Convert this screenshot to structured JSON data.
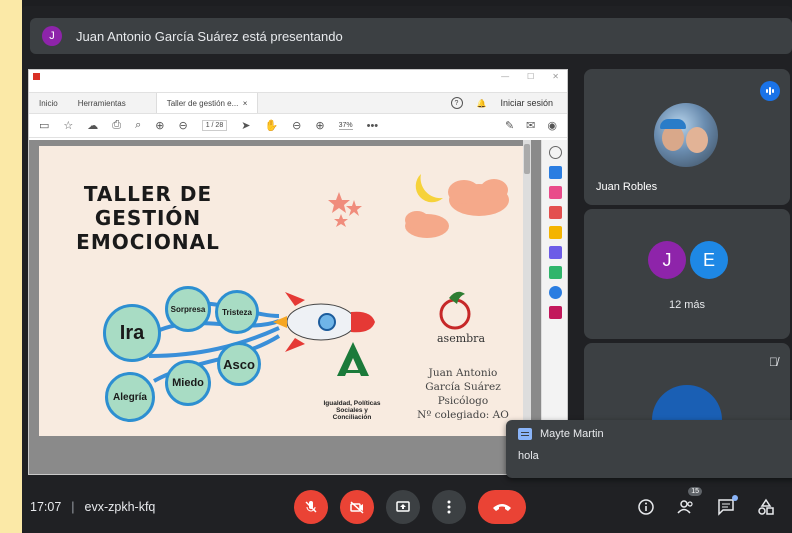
{
  "banner": {
    "avatar": "J",
    "text": "Juan Antonio García Suárez está presentando"
  },
  "presentation": {
    "tabs": [
      "Inicio",
      "Herramientas",
      "Taller de gestión e..."
    ],
    "sign_in": "Iniciar sesión",
    "page_indicator": "1 / 28",
    "zoom": "37%",
    "slide": {
      "title_lines": [
        "TALLER DE",
        "GESTIÓN",
        "EMOCIONAL"
      ],
      "emotions": [
        "Ira",
        "Sorpresa",
        "Tristeza",
        "Asco",
        "Miedo",
        "Alegría"
      ],
      "org_logo_text": "asembra",
      "gov_text": "Igualdad, Políticas Sociales y Conciliación",
      "credits": [
        "Juan Antonio",
        "García Suárez",
        "Psicólogo",
        "Nº colegiado: AO"
      ]
    }
  },
  "participants": {
    "tile1_name": "Juan Robles",
    "tile2_avatars": [
      "J",
      "E"
    ],
    "tile2_avatar_colors": [
      "#8e24aa",
      "#1e88e5"
    ],
    "tile2_more": "12 más"
  },
  "toast": {
    "sender": "Mayte Martin",
    "message": "hola"
  },
  "bottom": {
    "time": "17:07",
    "meeting_code": "evx-zpkh-kfq",
    "participants_count": "15"
  },
  "colors": {
    "danger": "#ea4335",
    "accent": "#1a73e8"
  }
}
